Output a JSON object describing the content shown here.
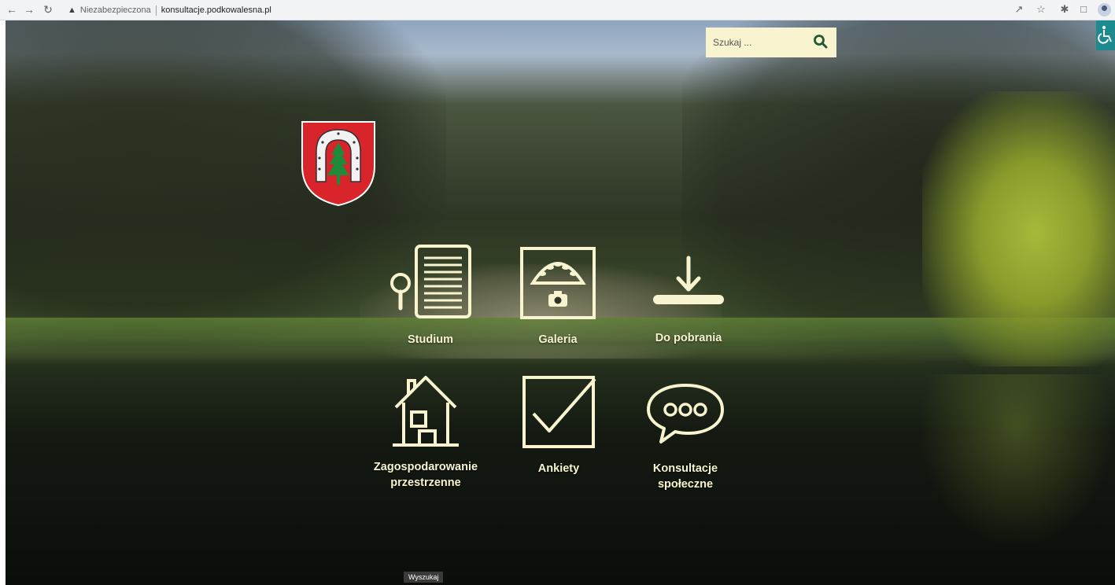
{
  "browser": {
    "insecure_label": "Niezabezpieczona",
    "url": "konsultacje.podkowalesna.pl"
  },
  "search": {
    "placeholder": "Szukaj ..."
  },
  "tiles": [
    {
      "label": "Studium",
      "icon": "document-search-icon"
    },
    {
      "label": "Galeria",
      "icon": "gallery-camera-icon"
    },
    {
      "label": "Do pobrania",
      "icon": "download-icon"
    },
    {
      "label": "Zagospodarowanie przestrzenne",
      "icon": "house-icon"
    },
    {
      "label": "Ankiety",
      "icon": "checkbox-icon"
    },
    {
      "label": "Konsultacje społeczne",
      "icon": "chat-bubble-icon"
    }
  ],
  "tooltip": "Wyszukaj",
  "colors": {
    "accent_cream": "#f8f4cf",
    "search_icon": "#1f5a32",
    "accessibility": "#1b8b8f",
    "crest_red": "#d8242a"
  }
}
